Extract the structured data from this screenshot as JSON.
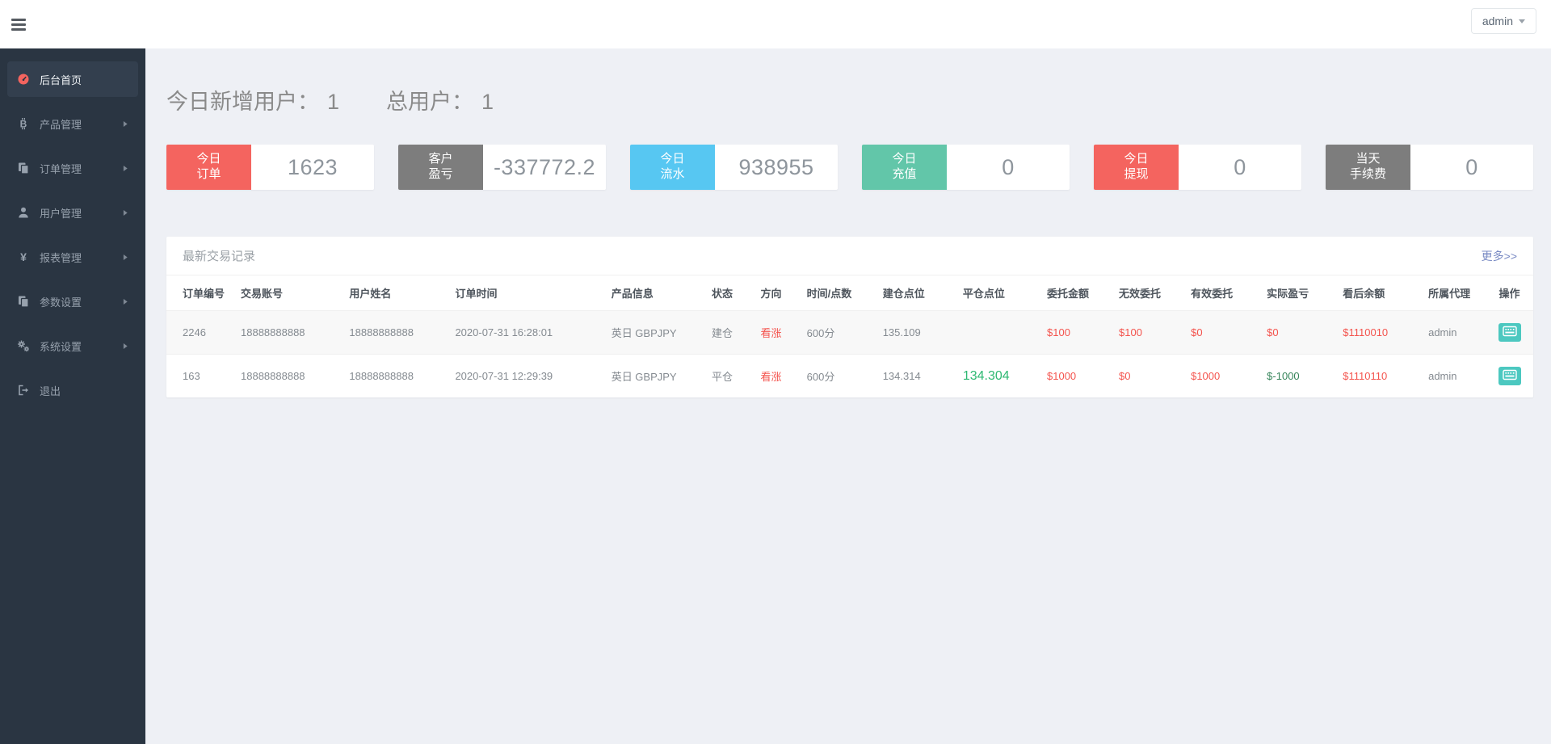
{
  "colors": {
    "accent_red": "#f4645f",
    "accent_gray": "#7d7d7d",
    "accent_blue": "#57c7f2",
    "accent_teal": "#62c6a9",
    "money_red": "#f4544e",
    "gain_green": "#2eb872",
    "loss_green": "#37855b",
    "action_teal": "#4cc8c0",
    "link_blue": "#7a8bc4",
    "sidebar_bg": "#2a3542"
  },
  "topbar": {
    "user_label": "admin"
  },
  "sidebar": {
    "items": [
      {
        "label": "后台首页",
        "icon": "dashboard-icon",
        "active": true,
        "has_arrow": false
      },
      {
        "label": "产品管理",
        "icon": "bitcoin-icon",
        "active": false,
        "has_arrow": true
      },
      {
        "label": "订单管理",
        "icon": "copy-icon",
        "active": false,
        "has_arrow": true
      },
      {
        "label": "用户管理",
        "icon": "user-icon",
        "active": false,
        "has_arrow": true
      },
      {
        "label": "报表管理",
        "icon": "yen-icon",
        "active": false,
        "has_arrow": true
      },
      {
        "label": "参数设置",
        "icon": "copy-icon",
        "active": false,
        "has_arrow": true
      },
      {
        "label": "系统设置",
        "icon": "gears-icon",
        "active": false,
        "has_arrow": true
      },
      {
        "label": "退出",
        "icon": "signout-icon",
        "active": false,
        "has_arrow": false
      }
    ]
  },
  "overview": {
    "groups": [
      {
        "label": "今日新增用户：",
        "value": "1"
      },
      {
        "label": "总用户：",
        "value": "1"
      }
    ]
  },
  "stat_cards": [
    {
      "label_lines": [
        "今日",
        "订单"
      ],
      "value": "1623",
      "color": "#f4645f"
    },
    {
      "label_lines": [
        "客户",
        "盈亏"
      ],
      "value": "-337772.2",
      "color": "#7d7d7d"
    },
    {
      "label_lines": [
        "今日",
        "流水"
      ],
      "value": "938955",
      "color": "#57c7f2"
    },
    {
      "label_lines": [
        "今日",
        "充值"
      ],
      "value": "0",
      "color": "#62c6a9"
    },
    {
      "label_lines": [
        "今日",
        "提现"
      ],
      "value": "0",
      "color": "#f4645f"
    },
    {
      "label_lines": [
        "当天",
        "手续费"
      ],
      "value": "0",
      "color": "#7d7d7d"
    }
  ],
  "panel": {
    "title": "最新交易记录",
    "more_label": "更多>>",
    "table": {
      "headers": [
        "订单编号",
        "交易账号",
        "用户姓名",
        "订单时间",
        "产品信息",
        "状态",
        "方向",
        "时间/点数",
        "建仓点位",
        "平仓点位",
        "委托金额",
        "无效委托",
        "有效委托",
        "实际盈亏",
        "看后余额",
        "所属代理",
        "操作"
      ],
      "rows": [
        {
          "cells": [
            {
              "t": "2246"
            },
            {
              "t": "18888888888"
            },
            {
              "t": "18888888888"
            },
            {
              "t": "2020-07-31 16:28:01"
            },
            {
              "t": "英日 GBPJPY"
            },
            {
              "t": "建仓"
            },
            {
              "t": "看涨",
              "c": "red"
            },
            {
              "t": "600分"
            },
            {
              "t": "135.109"
            },
            {
              "t": ""
            },
            {
              "t": "$100",
              "c": "red"
            },
            {
              "t": "$100",
              "c": "red"
            },
            {
              "t": "$0",
              "c": "red"
            },
            {
              "t": "$0",
              "c": "red"
            },
            {
              "t": "$1110010",
              "c": "red"
            },
            {
              "t": "admin"
            },
            {
              "action": true,
              "icon": "keyboard-icon"
            }
          ]
        },
        {
          "cells": [
            {
              "t": "163"
            },
            {
              "t": "18888888888"
            },
            {
              "t": "18888888888"
            },
            {
              "t": "2020-07-31 12:29:39"
            },
            {
              "t": "英日 GBPJPY"
            },
            {
              "t": "平仓"
            },
            {
              "t": "看涨",
              "c": "red"
            },
            {
              "t": "600分"
            },
            {
              "t": "134.314"
            },
            {
              "t": "134.304",
              "c": "green-big"
            },
            {
              "t": "$1000",
              "c": "red"
            },
            {
              "t": "$0",
              "c": "red"
            },
            {
              "t": "$1000",
              "c": "red"
            },
            {
              "t": "$-1000",
              "c": "green-dark"
            },
            {
              "t": "$1110110",
              "c": "red"
            },
            {
              "t": "admin"
            },
            {
              "action": true,
              "icon": "keyboard-icon"
            }
          ]
        }
      ]
    }
  }
}
